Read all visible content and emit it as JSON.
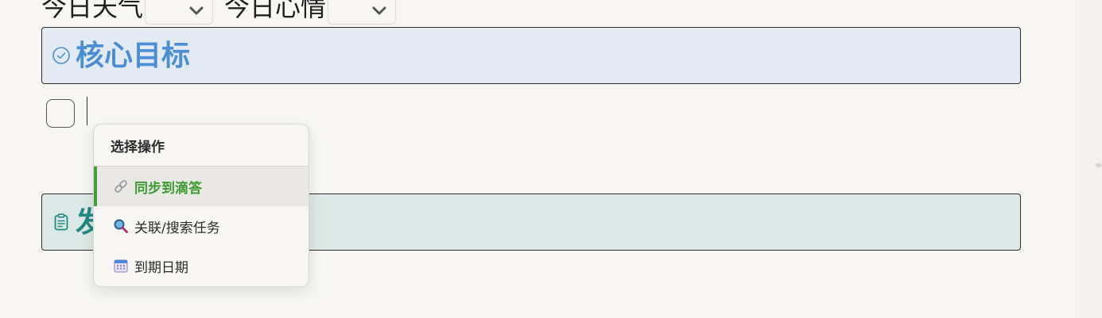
{
  "properties": {
    "weather_label": "今日天气",
    "mood_label": "今日心情"
  },
  "callouts": {
    "goal_title": "核心目标",
    "second_title": "发"
  },
  "menu": {
    "header": "选择操作",
    "items": [
      {
        "label": "同步到滴答",
        "icon": "link-icon",
        "active": true
      },
      {
        "label": "关联/搜索任务",
        "icon": "magnifier-icon",
        "active": false
      },
      {
        "label": "到期日期",
        "icon": "calendar-icon",
        "active": false
      }
    ]
  },
  "colors": {
    "goal_accent": "#4a8fd4",
    "second_accent": "#1f8a82",
    "active_item": "#3b9a2f"
  }
}
